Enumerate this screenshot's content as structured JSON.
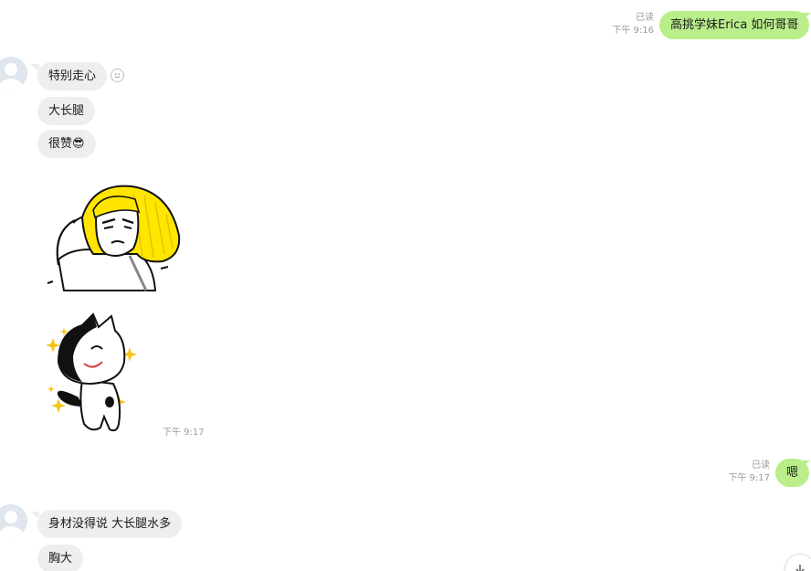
{
  "messages": [
    {
      "id": "m1",
      "side": "out",
      "text": "高挑学妹Erica 如何哥哥",
      "read": "已读",
      "time": "下午 9:16"
    },
    {
      "id": "m2",
      "side": "in",
      "text": "特别走心"
    },
    {
      "id": "m3",
      "side": "in",
      "text": "大长腿"
    },
    {
      "id": "m4",
      "side": "in",
      "text": "很赞😎"
    },
    {
      "id": "m5",
      "side": "in",
      "sticker": "saluting-blonde-sticker"
    },
    {
      "id": "m6",
      "side": "in",
      "sticker": "sparkling-cat-sticker",
      "time": "下午 9:17"
    },
    {
      "id": "m7",
      "side": "out",
      "text": "嗯",
      "read": "已读",
      "time": "下午 9:17"
    },
    {
      "id": "m8",
      "side": "in",
      "text": "身材没得说 大长腿水多"
    },
    {
      "id": "m9",
      "side": "in",
      "text": "胸大"
    }
  ],
  "icons": {
    "avatar": "default-avatar-icon",
    "reaction": "smiley-icon",
    "scroll": "arrow-down-icon"
  },
  "colors": {
    "outgoing_bubble": "#b9ee8a",
    "incoming_bubble": "#eeeeee",
    "meta_text": "#9a9a9a",
    "sticker_yellow": "#ffe500"
  }
}
